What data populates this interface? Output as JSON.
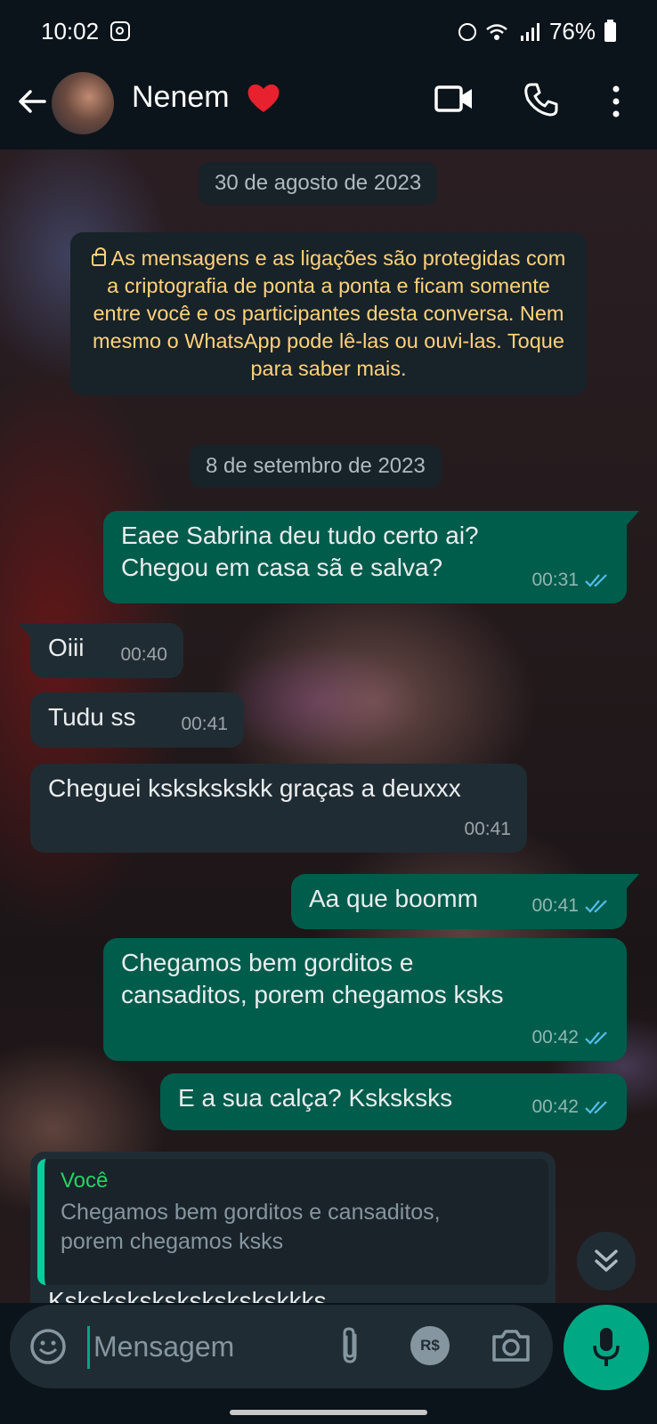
{
  "status_bar": {
    "time": "10:02",
    "battery": "76%"
  },
  "header": {
    "contact_name": "Nenem"
  },
  "chat": {
    "date1": "30 de agosto de 2023",
    "encryption_notice": "As mensagens e as ligações são protegidas com a criptografia de ponta a ponta e ficam somente entre você e os participantes desta conversa. Nem mesmo o WhatsApp pode lê-las ou ouvi-las. Toque para saber mais.",
    "date2": "8 de setembro de 2023",
    "messages": [
      {
        "direction": "out",
        "line1": "Eaee Sabrina deu tudo certo ai?",
        "line2": "Chegou em casa sã e salva?",
        "time": "00:31"
      },
      {
        "direction": "in",
        "text": "Oiii",
        "time": "00:40"
      },
      {
        "direction": "in",
        "text": "Tudu ss",
        "time": "00:41"
      },
      {
        "direction": "in",
        "text": "Cheguei kskskskskk graças a deuxxx",
        "time": "00:41"
      },
      {
        "direction": "out",
        "text": "Aa que boomm",
        "time": "00:41"
      },
      {
        "direction": "out",
        "line1": "Chegamos bem gorditos e",
        "line2": "cansaditos, porem chegamos ksks",
        "time": "00:42"
      },
      {
        "direction": "out",
        "text": "E a sua calça? Ksksksks",
        "time": "00:42"
      }
    ],
    "reply": {
      "quoted_author": "Você",
      "quoted_line1": "Chegamos bem gorditos e cansaditos,",
      "quoted_line2": "porem chegamos ksks",
      "partial_text": "Kskskskskskskskskskkks"
    }
  },
  "input": {
    "placeholder": "Mensagem",
    "rs_label": "R$"
  },
  "colors": {
    "outgoing": "#005c4b",
    "incoming": "#202c33",
    "accent": "#00a884",
    "notice_text": "#ffd279"
  },
  "icons": [
    "back-arrow-icon",
    "heart-emoji-icon",
    "video-call-icon",
    "voice-call-icon",
    "more-options-icon",
    "lock-icon",
    "double-check-icon",
    "scroll-down-icon",
    "emoji-icon",
    "attach-icon",
    "payment-icon",
    "camera-icon",
    "mic-icon"
  ]
}
